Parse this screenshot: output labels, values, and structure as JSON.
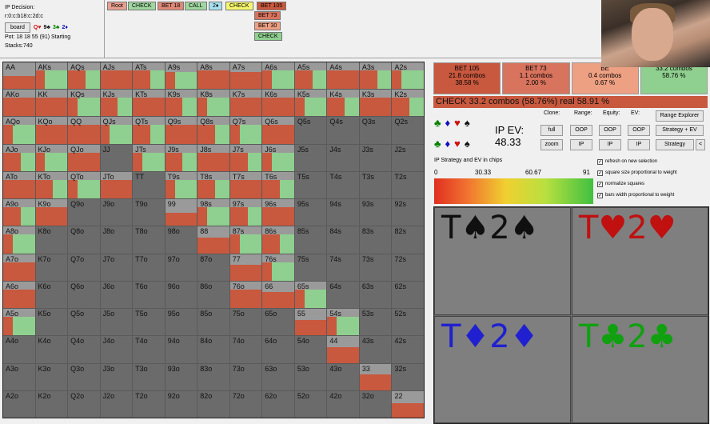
{
  "info": {
    "title": "IP Decision:",
    "board_code": "r:0:c:b18:c:2d:c",
    "board_button": "board",
    "board_cards": [
      {
        "text": "Q♥",
        "color": "#d01010"
      },
      {
        "text": "9♣",
        "color": "#101010"
      },
      {
        "text": "3♣",
        "color": "#008000"
      },
      {
        "text": "2♦",
        "color": "#1010c0"
      }
    ],
    "pot": "Pot: 18 18 55 (91) Starting Stacks:740"
  },
  "tree": [
    {
      "label": "Root",
      "color": "#e8a090"
    },
    {
      "label": "CHECK",
      "color": "#9fd79f"
    },
    {
      "label": "BET 18",
      "color": "#e08878"
    },
    {
      "label": "CALL",
      "color": "#9fd79f"
    },
    {
      "label": "2♦",
      "color": "#a6e0f0"
    },
    {
      "label": "CHECK",
      "color": "#f7f76f"
    },
    {
      "label": "BET 105",
      "color": "#c8583e"
    },
    {
      "label": "BET 73",
      "color": "#d8735e"
    },
    {
      "label": "BET 30",
      "color": "#eea083"
    },
    {
      "label": "CHECK",
      "color": "#8fcf8f"
    }
  ],
  "hands": {
    "rows": [
      [
        "AA",
        "AKs",
        "AQs",
        "AJs",
        "ATs",
        "A9s",
        "A8s",
        "A7s",
        "A6s",
        "A5s",
        "A4s",
        "A3s",
        "A2s"
      ],
      [
        "AKo",
        "KK",
        "KQs",
        "KJs",
        "KTs",
        "K9s",
        "K8s",
        "K7s",
        "K6s",
        "K5s",
        "K4s",
        "K3s",
        "K2s"
      ],
      [
        "AQo",
        "KQo",
        "QQ",
        "QJs",
        "QTs",
        "Q9s",
        "Q8s",
        "Q7s",
        "Q6s",
        "Q5s",
        "Q4s",
        "Q3s",
        "Q2s"
      ],
      [
        "AJo",
        "KJo",
        "QJo",
        "JJ",
        "JTs",
        "J9s",
        "J8s",
        "J7s",
        "J6s",
        "J5s",
        "J4s",
        "J3s",
        "J2s"
      ],
      [
        "ATo",
        "KTo",
        "QTo",
        "JTo",
        "TT",
        "T9s",
        "T8s",
        "T7s",
        "T6s",
        "T5s",
        "T4s",
        "T3s",
        "T2s"
      ],
      [
        "A9o",
        "K9o",
        "Q9o",
        "J9o",
        "T9o",
        "99",
        "98s",
        "97s",
        "96s",
        "95s",
        "94s",
        "93s",
        "92s"
      ],
      [
        "A8o",
        "K8o",
        "Q8o",
        "J8o",
        "T8o",
        "98o",
        "88",
        "87s",
        "86s",
        "85s",
        "84s",
        "83s",
        "82s"
      ],
      [
        "A7o",
        "K7o",
        "Q7o",
        "J7o",
        "T7o",
        "97o",
        "87o",
        "77",
        "76s",
        "75s",
        "74s",
        "73s",
        "72s"
      ],
      [
        "A6o",
        "K6o",
        "Q6o",
        "J6o",
        "T6o",
        "96o",
        "86o",
        "76o",
        "66",
        "65s",
        "64s",
        "63s",
        "62s"
      ],
      [
        "A5o",
        "K5o",
        "Q5o",
        "J5o",
        "T5o",
        "95o",
        "85o",
        "75o",
        "65o",
        "55",
        "54s",
        "53s",
        "52s"
      ],
      [
        "A4o",
        "K4o",
        "Q4o",
        "J4o",
        "T4o",
        "94o",
        "84o",
        "74o",
        "64o",
        "54o",
        "44",
        "43s",
        "42s"
      ],
      [
        "A3o",
        "K3o",
        "Q3o",
        "J3o",
        "T3o",
        "93o",
        "83o",
        "73o",
        "63o",
        "53o",
        "43o",
        "33",
        "32s"
      ],
      [
        "A2o",
        "K2o",
        "Q2o",
        "J2o",
        "T2o",
        "92o",
        "82o",
        "72o",
        "62o",
        "52o",
        "42o",
        "32o",
        "22"
      ]
    ],
    "fill": [
      [
        0.6,
        1,
        1,
        1,
        1,
        0.9,
        1,
        0.9,
        1,
        1,
        1,
        1,
        1
      ],
      [
        1,
        1,
        1,
        1,
        1,
        1,
        1,
        1,
        1,
        1,
        1,
        1,
        1
      ],
      [
        1,
        1,
        1,
        1,
        1,
        1,
        1,
        1,
        1,
        0,
        0,
        0,
        0
      ],
      [
        1,
        1,
        1,
        0,
        1,
        1,
        1,
        1,
        1,
        0,
        0,
        0,
        0
      ],
      [
        1,
        1,
        1,
        1,
        0,
        1,
        1,
        1,
        1,
        0,
        0,
        0,
        0
      ],
      [
        1,
        1,
        0,
        0,
        0,
        0.6,
        1,
        1,
        1,
        0,
        0,
        0,
        0
      ],
      [
        1,
        0,
        0,
        0,
        0,
        0,
        0.8,
        1,
        1,
        0,
        0,
        0,
        0
      ],
      [
        1,
        0,
        0,
        0,
        0,
        0,
        0,
        0.8,
        1,
        0,
        0,
        0,
        0
      ],
      [
        1,
        0,
        0,
        0,
        0,
        0,
        0,
        1,
        0.8,
        1,
        0,
        0,
        0
      ],
      [
        1,
        0,
        0,
        0,
        0,
        0,
        0,
        0,
        0,
        0.8,
        1,
        0,
        0
      ],
      [
        0,
        0,
        0,
        0,
        0,
        0,
        0,
        0,
        0,
        0,
        0.8,
        0,
        0
      ],
      [
        0,
        0,
        0,
        0,
        0,
        0,
        0,
        0,
        0,
        0,
        0,
        0.8,
        0
      ],
      [
        0,
        0,
        0,
        0,
        0,
        0,
        0,
        0,
        0,
        0,
        0,
        0,
        0.7
      ]
    ],
    "colors": {
      "bet": "#c8583e",
      "check": "#8fcf8f"
    }
  },
  "actions": [
    {
      "label": "BET 105",
      "combos": "21.8 combos",
      "pct": "38.58 %",
      "color": "#c8583e"
    },
    {
      "label": "BET 73",
      "combos": "1.1 combos",
      "pct": "2.00 %",
      "color": "#d8735e"
    },
    {
      "label": "BE",
      "combos": "0.4 combos",
      "pct": "0.67 %",
      "color": "#eea083"
    },
    {
      "label": "",
      "combos": "33.2 combos",
      "pct": "58.76 %",
      "color": "#8fcf8f"
    }
  ],
  "check_bar": "CHECK  33.2 combos (58.76%) real  58.91 %",
  "suits": {
    "row1": [
      {
        "s": "♣",
        "c": "#008000"
      },
      {
        "s": "♦",
        "c": "#1010c0"
      },
      {
        "s": "♥",
        "c": "#d01010"
      },
      {
        "s": "♠",
        "c": "#101010"
      }
    ],
    "row2": [
      {
        "s": "♣",
        "c": "#008000"
      },
      {
        "s": "♦",
        "c": "#1010c0"
      },
      {
        "s": "♥",
        "c": "#d01010"
      },
      {
        "s": "♠",
        "c": "#101010"
      }
    ]
  },
  "ev": {
    "label": "IP EV:",
    "value": "48.33"
  },
  "controls": {
    "clone": "Clone:",
    "range": "Range:",
    "equity": "Equity:",
    "ev": "EV:",
    "full": "full",
    "zoom": "zoom",
    "oop": "OOP",
    "ip": "IP",
    "range_explorer": "Range Explorer",
    "strategy_ev": "Strategy + EV",
    "strategy": "Strategy",
    "arrow": "<"
  },
  "scale": {
    "title": "IP Strategy and EV in chips",
    "ticks": [
      "0",
      "30.33",
      "60.67",
      "91"
    ]
  },
  "checkboxes": [
    "refresh on new selection",
    "square size proportional to weight",
    "normalize squares",
    "bars width proportional to weight"
  ],
  "combos": [
    {
      "rank1": "T",
      "suit1": "♠",
      "rank2": "2",
      "suit2": "♠",
      "color": "#101010"
    },
    {
      "rank1": "T",
      "suit1": "♥",
      "rank2": "2",
      "suit2": "♥",
      "color": "#c01010"
    },
    {
      "rank1": "T",
      "suit1": "♦",
      "rank2": "2",
      "suit2": "♦",
      "color": "#2020d0"
    },
    {
      "rank1": "T",
      "suit1": "♣",
      "rank2": "2",
      "suit2": "♣",
      "color": "#10a010"
    }
  ]
}
